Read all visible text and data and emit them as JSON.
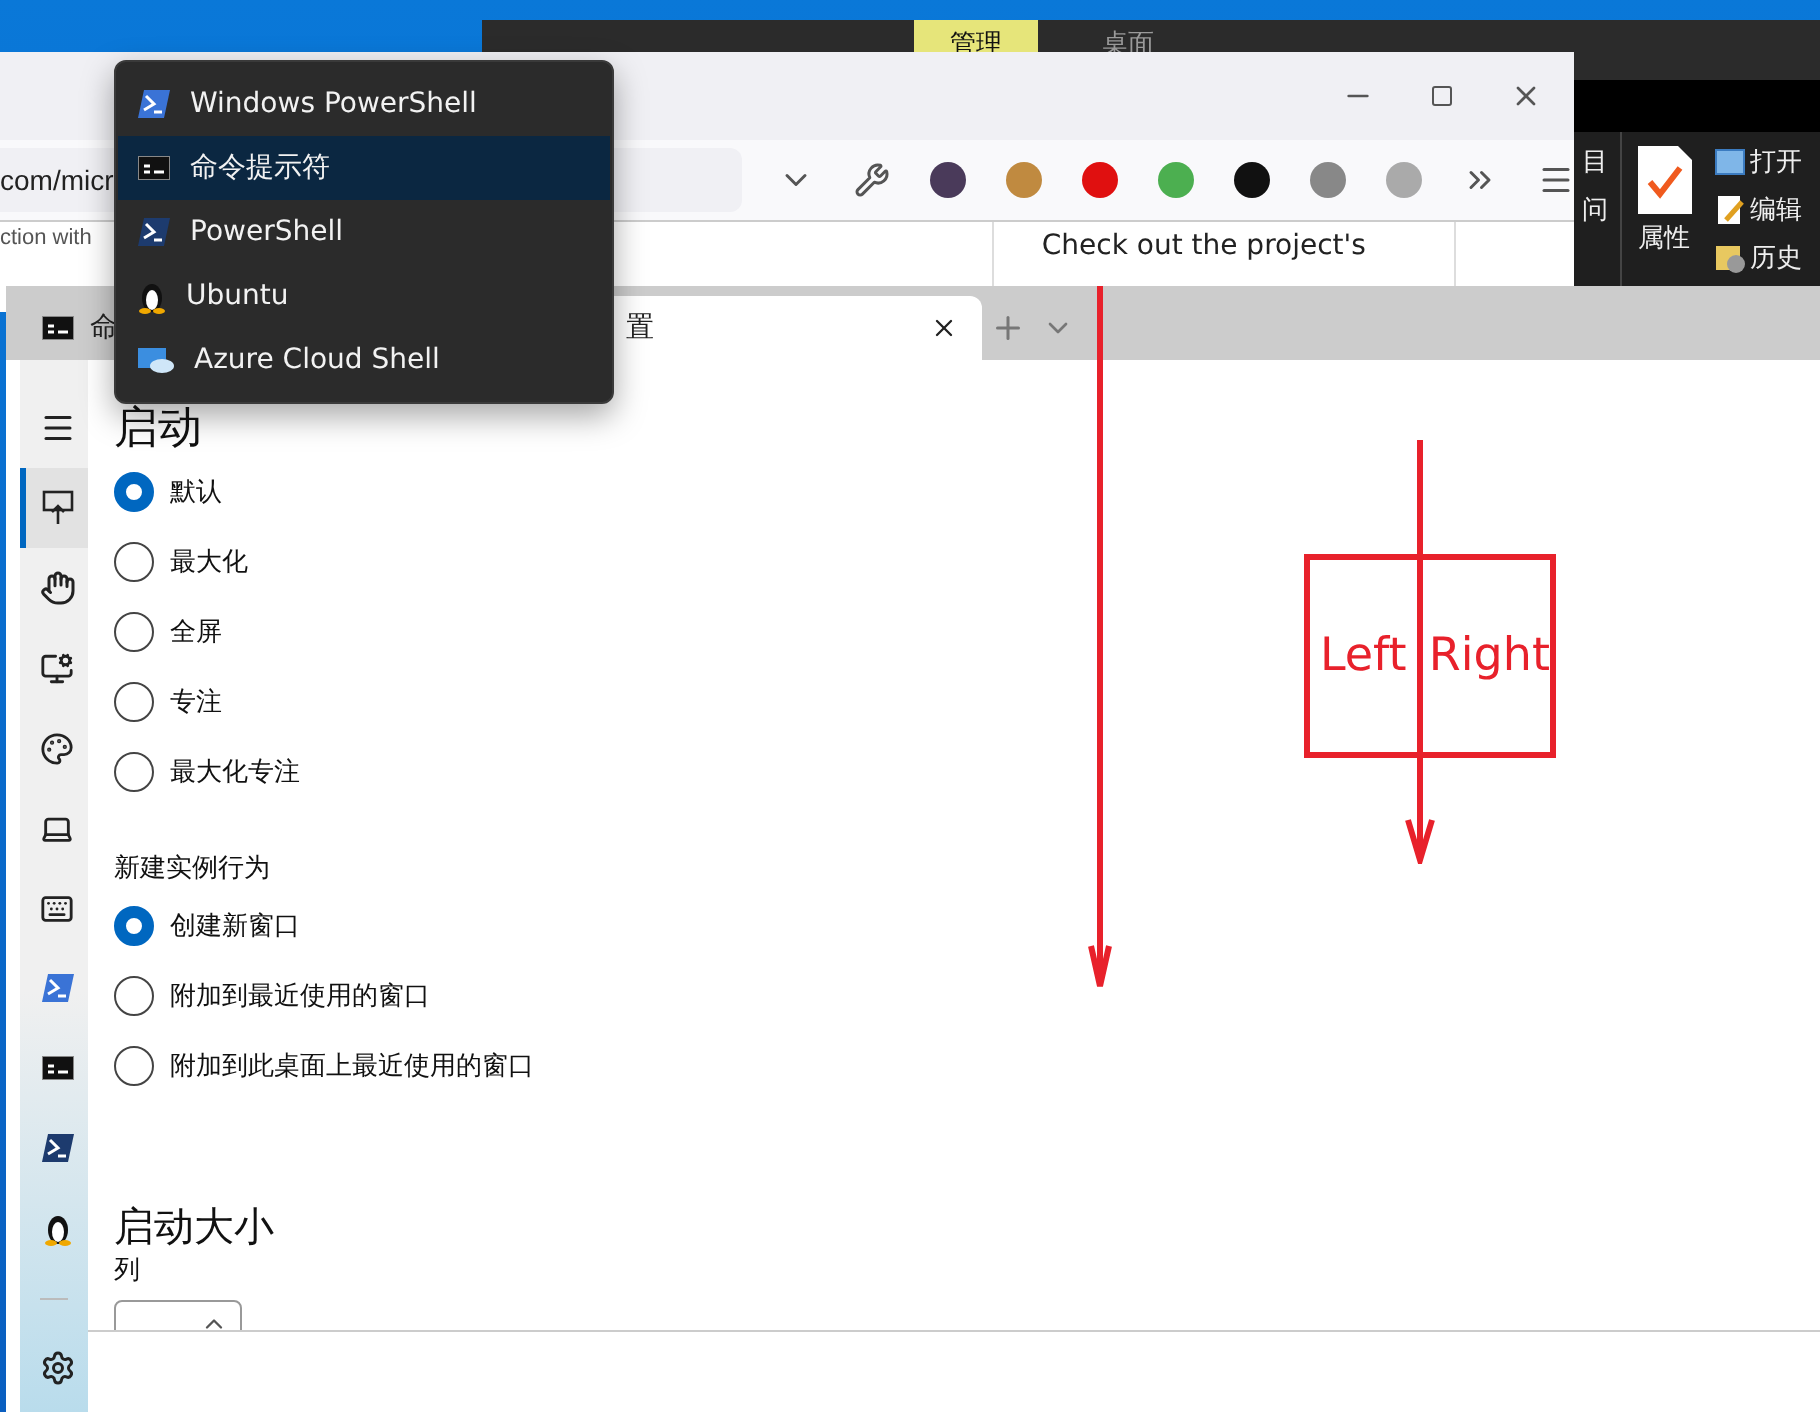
{
  "explorer": {
    "ribbon_tabs": [
      {
        "label": "管理",
        "selected": true
      },
      {
        "label": "桌面",
        "selected": false
      }
    ],
    "ribbon_left": [
      "目",
      "问"
    ],
    "ribbon_main": {
      "label": "属性"
    },
    "ribbon_actions": [
      {
        "label": "打开",
        "kind": "open"
      },
      {
        "label": "编辑",
        "kind": "edit"
      },
      {
        "label": "历史",
        "kind": "history"
      }
    ]
  },
  "browser": {
    "address": "com/micr",
    "side_text": "ction with",
    "content_text": "Check out the project's"
  },
  "terminal": {
    "tabs": [
      {
        "label": "命",
        "kind": "cmd",
        "selected": false
      },
      {
        "label": "置",
        "kind": "settings",
        "selected": true
      }
    ],
    "sidebar": [
      {
        "kind": "menu",
        "selected": false
      },
      {
        "kind": "launch",
        "selected": true
      },
      {
        "kind": "interaction",
        "selected": false
      },
      {
        "kind": "appearance",
        "selected": false
      },
      {
        "kind": "colors",
        "selected": false
      },
      {
        "kind": "rendering",
        "selected": false
      },
      {
        "kind": "actions",
        "selected": false
      },
      {
        "kind": "powershell",
        "selected": false
      },
      {
        "kind": "cmd",
        "selected": false
      },
      {
        "kind": "pwsh",
        "selected": false
      },
      {
        "kind": "linux",
        "selected": false
      },
      {
        "kind": "divider"
      },
      {
        "kind": "settings",
        "selected": false
      }
    ],
    "launch_mode": {
      "heading": "启动",
      "options": [
        {
          "label": "默认",
          "selected": true
        },
        {
          "label": "最大化",
          "selected": false
        },
        {
          "label": "全屏",
          "selected": false
        },
        {
          "label": "专注",
          "selected": false
        },
        {
          "label": "最大化专注",
          "selected": false
        }
      ]
    },
    "new_instance": {
      "label": "新建实例行为",
      "options": [
        {
          "label": "创建新窗口",
          "selected": true
        },
        {
          "label": "附加到最近使用的窗口",
          "selected": false
        },
        {
          "label": "附加到此桌面上最近使用的窗口",
          "selected": false
        }
      ]
    },
    "launch_size": {
      "heading": "启动大小",
      "columns_label": "列"
    }
  },
  "dropdown_menu": {
    "items": [
      {
        "label": "Windows PowerShell",
        "kind": "powershell",
        "selected": false
      },
      {
        "label": "命令提示符",
        "kind": "cmd",
        "selected": true
      },
      {
        "label": "PowerShell",
        "kind": "pwsh",
        "selected": false
      },
      {
        "label": "Ubuntu",
        "kind": "linux",
        "selected": false
      },
      {
        "label": "Azure Cloud Shell",
        "kind": "azure",
        "selected": false
      }
    ]
  },
  "annotation": {
    "labels": [
      "Left",
      "Right"
    ]
  }
}
